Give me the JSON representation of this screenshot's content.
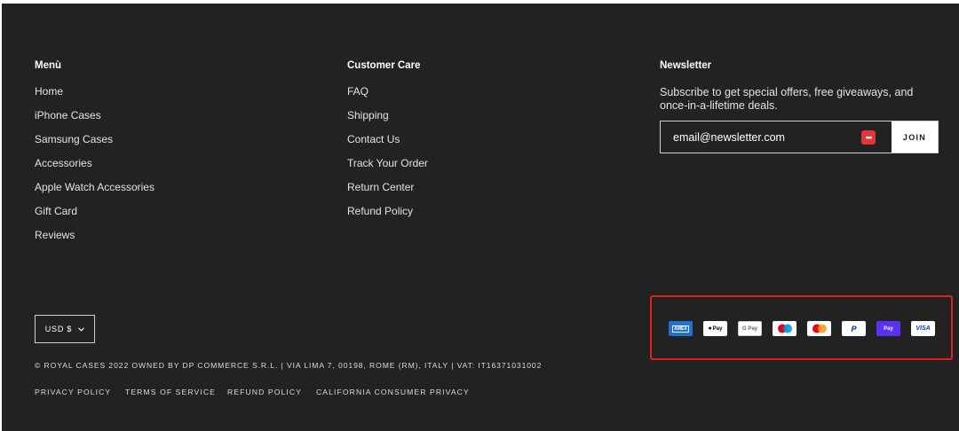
{
  "menu": {
    "title": "Menù",
    "items": [
      "Home",
      "iPhone Cases",
      "Samsung Cases",
      "Accessories",
      "Apple Watch Accessories",
      "Gift Card",
      "Reviews"
    ]
  },
  "customer_care": {
    "title": "Customer Care",
    "items": [
      "FAQ",
      "Shipping",
      "Contact Us",
      "Track Your Order",
      "Return Center",
      "Refund Policy"
    ]
  },
  "newsletter": {
    "title": "Newsletter",
    "description": "Subscribe to get special offers, free giveaways, and once-in-a-lifetime deals.",
    "input_value": "email@newsletter.com",
    "join_label": "JOIN",
    "password_icon": "password-manager-icon"
  },
  "currency": {
    "label": "USD $",
    "icon": "chevron-down-icon"
  },
  "copyright": "© ROYAL CASES 2022 OWNED BY DP COMMERCE S.R.L. | VIA LIMA 7, 00198, ROME (RM), ITALY | VAT: IT16371031002",
  "legal_links": [
    "PRIVACY POLICY",
    "TERMS OF SERVICE",
    "REFUND POLICY",
    "CALIFORNIA CONSUMER PRIVACY"
  ],
  "payment_methods": [
    {
      "icon": "amex-icon",
      "label": "AMEX",
      "bg": "#1f72cd",
      "fg": "#ffffff"
    },
    {
      "icon": "apple-pay-icon",
      "label": "Pay",
      "bg": "#ffffff",
      "fg": "#000000"
    },
    {
      "icon": "google-pay-icon",
      "label": "G Pay",
      "bg": "#ffffff",
      "fg": "#5f6368"
    },
    {
      "icon": "maestro-icon",
      "label": "",
      "bg": "#ffffff",
      "fg": "#000000"
    },
    {
      "icon": "mastercard-icon",
      "label": "",
      "bg": "#ffffff",
      "fg": "#000000"
    },
    {
      "icon": "paypal-icon",
      "label": "P",
      "bg": "#ffffff",
      "fg": "#003087"
    },
    {
      "icon": "shop-pay-icon",
      "label": "Pay",
      "bg": "#5a31f4",
      "fg": "#ffffff"
    },
    {
      "icon": "visa-icon",
      "label": "VISA",
      "bg": "#ffffff",
      "fg": "#1434cb"
    }
  ],
  "colors": {
    "background": "#232222",
    "text": "#e3e3e3",
    "highlight_border": "#e02020"
  }
}
